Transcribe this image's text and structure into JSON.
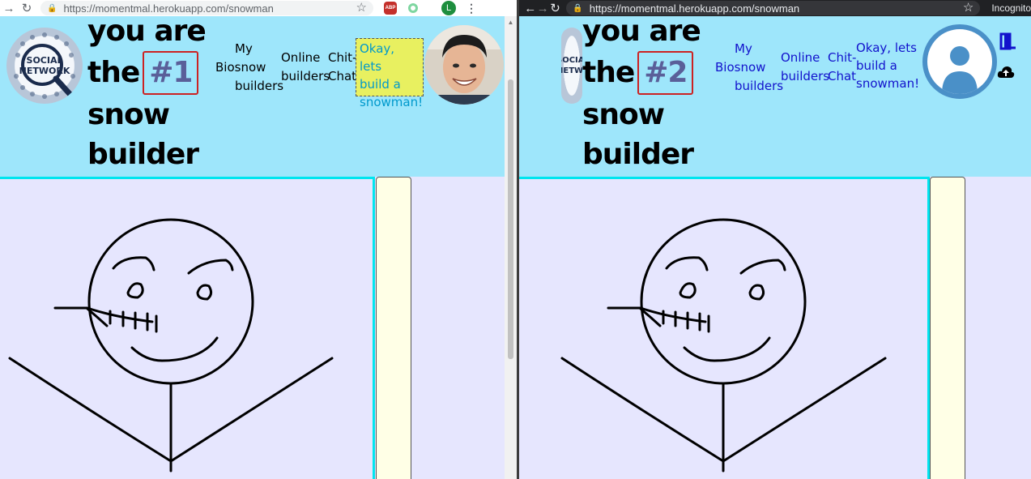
{
  "windows": {
    "left": {
      "url": "https://momentmal.herokuapp.com/snowman",
      "logo_text": [
        "SOCIAL",
        "NETWORK"
      ],
      "heading_prefix": [
        "you are",
        "the"
      ],
      "rank": "#1",
      "heading_suffix": [
        "snow",
        "builder"
      ],
      "nav": {
        "my_label": "My",
        "biosnow_label": "Biosnow",
        "builders_label": "builders",
        "online_label": "Online",
        "online_builders_label": "builders",
        "chit_label": "Chit-",
        "chat_label": "Chat"
      },
      "cta_lines": [
        "Okay, lets",
        "build a",
        "snowman!"
      ],
      "extensions": {
        "abp": "ABP",
        "profile_initial": "L"
      }
    },
    "right": {
      "url": "https://momentmal.herokuapp.com/snowman",
      "logo_text": [
        "SOCIAL",
        "NETWORK"
      ],
      "heading_prefix": [
        "you are",
        "the"
      ],
      "rank": "#2",
      "heading_suffix": [
        "snow",
        "builder"
      ],
      "nav": {
        "my_label": "My",
        "biosnow_label": "Biosnow",
        "builders_label": "builders",
        "online_label": "Online",
        "online_builders_label": "builders",
        "chit_label": "Chit-",
        "chat_label": "Chat"
      },
      "cta_lines": [
        "Okay, lets",
        "build a",
        "snowman!"
      ],
      "incognito_label": "Incognito"
    }
  },
  "colors": {
    "header_bg": "#9ee6fb",
    "canvas_bg": "#e6e6fe",
    "canvas_border": "#00e5ef",
    "side_panel_bg": "#ffffe6",
    "rank_border": "#cc2222",
    "rank_text": "#5a5f99",
    "cta_bg": "#e8f060",
    "cta_text_left": "#0099cc",
    "link_right": "#1212cc"
  }
}
